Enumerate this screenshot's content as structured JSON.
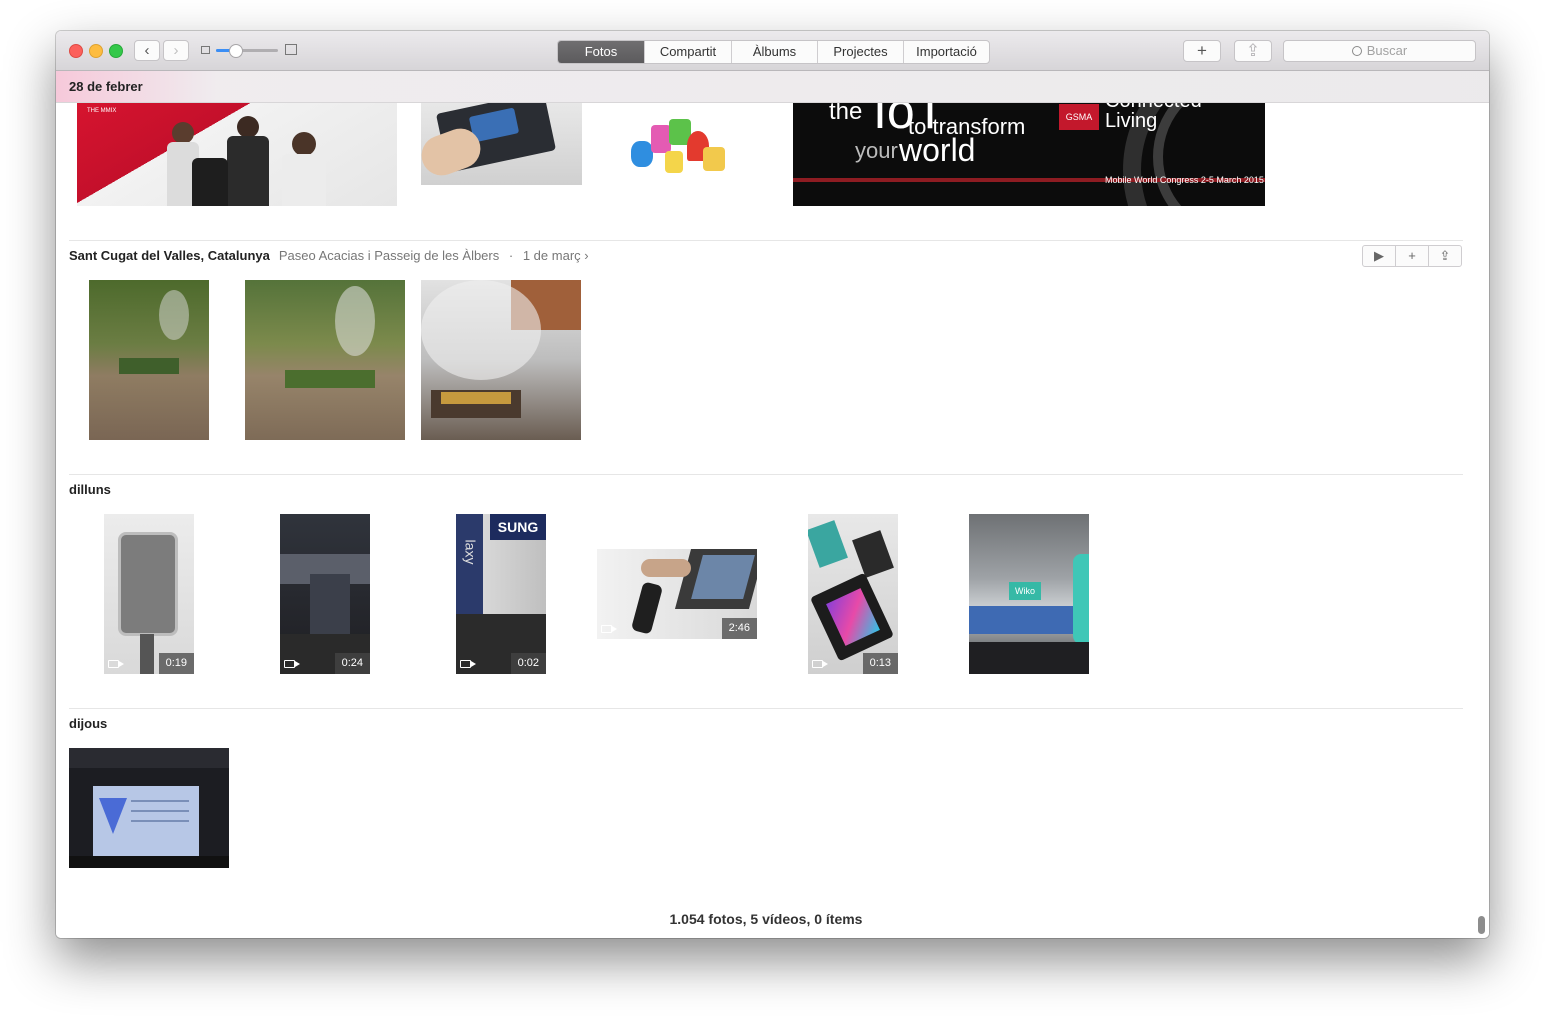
{
  "window": {
    "nav": {
      "back": "‹",
      "forward": "›"
    },
    "zoom_level": 0.3,
    "tabs": [
      "Fotos",
      "Compartit",
      "Àlbums",
      "Projectes",
      "Importació"
    ],
    "active_tab": "Fotos",
    "add_label": "+",
    "share_label": "⇪",
    "search_placeholder": "Buscar"
  },
  "sticky_header": {
    "date": "28 de febrer"
  },
  "poster": {
    "line1": "the",
    "line2": "IoT",
    "line3": "to transform",
    "line4": "your",
    "line5": "world",
    "brand": "GSMA",
    "tag1": "Connected",
    "tag2": "Living",
    "footer": "Mobile World Congress 2-5 March 2015",
    "album_text": "THE MMIX"
  },
  "moments": [
    {
      "title": "Sant Cugat del Valles, Catalunya",
      "subtitle": "Paseo Acacias i Passeig de les Àlbers",
      "separator": "·",
      "date": "1 de març ›",
      "actions": {
        "play": "▶",
        "add": "+",
        "share": "⇪"
      }
    },
    {
      "title": "dilluns"
    },
    {
      "title": "dijous"
    }
  ],
  "videos": {
    "v1": {
      "duration": "0:19"
    },
    "v2": {
      "duration": "0:24"
    },
    "v3": {
      "duration": "0:02"
    },
    "v4": {
      "duration": "2:46"
    },
    "v5": {
      "duration": "0:13"
    }
  },
  "thumb_text": {
    "samsung": "SUNG",
    "laxy": "laxy",
    "wiko": "Wiko"
  },
  "footer": {
    "summary": "1.054 fotos, 5 vídeos, 0 ítems"
  },
  "colors": {
    "accent": "#3b8ef5",
    "active_tab": "#5c5b5d",
    "sticky_tint": "#f6c6d8"
  }
}
